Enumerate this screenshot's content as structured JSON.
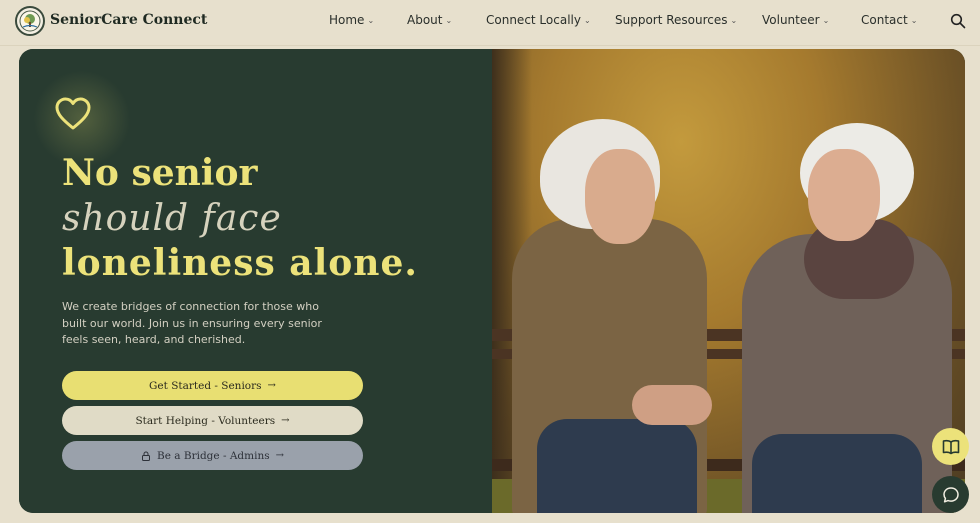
{
  "brand": {
    "name": "SeniorCare Connect",
    "logo_icon": "tree-logo-icon"
  },
  "nav": {
    "items": [
      {
        "label": "Home"
      },
      {
        "label": "About"
      },
      {
        "label": "Connect Locally"
      },
      {
        "label": "Support Resources"
      },
      {
        "label": "Volunteer"
      },
      {
        "label": "Contact"
      }
    ],
    "search_icon": "search-icon"
  },
  "hero": {
    "icon": "heart-icon",
    "headline": {
      "line1": "No senior",
      "line2": "should face",
      "line3": "loneliness alone."
    },
    "subtext": "We create bridges of connection for those who built our world. Join us in ensuring every senior feels seen, heard, and cherished.",
    "buttons": [
      {
        "label": "Get Started - Seniors"
      },
      {
        "label": "Start Helping - Volunteers"
      },
      {
        "label": "Be a Bridge - Admins"
      }
    ]
  },
  "floating": {
    "book_icon": "book-open-icon",
    "chat_icon": "chat-bubble-icon"
  },
  "colors": {
    "background": "#e7e0cd",
    "hero_dark": "#283b30",
    "accent_yellow": "#ece27a",
    "secondary_button": "#e0dbc6",
    "admin_button": "#9aa1ab"
  }
}
